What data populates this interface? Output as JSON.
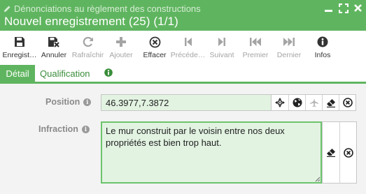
{
  "window": {
    "parent_title": "Dénonciations au règlement des constructions",
    "title": "Nouvel enregistrement (25) (1/1)"
  },
  "toolbar": {
    "buttons": [
      {
        "label": "Enregist…",
        "icon": "save-icon",
        "enabled": true
      },
      {
        "label": "Annuler",
        "icon": "cancel-save-icon",
        "enabled": true
      },
      {
        "label": "Rafraîchir",
        "icon": "refresh-icon",
        "enabled": false
      },
      {
        "label": "Ajouter",
        "icon": "plus-icon",
        "enabled": false
      },
      {
        "label": "Effacer",
        "icon": "delete-icon",
        "enabled": true
      },
      {
        "label": "Précéde…",
        "icon": "previous-icon",
        "enabled": false
      },
      {
        "label": "Suivant",
        "icon": "next-icon",
        "enabled": false
      },
      {
        "label": "Premier",
        "icon": "first-icon",
        "enabled": false
      },
      {
        "label": "Dernier",
        "icon": "last-icon",
        "enabled": false
      },
      {
        "label": "Infos",
        "icon": "info-icon",
        "enabled": true
      }
    ]
  },
  "tabs": [
    {
      "label": "Détail",
      "active": true
    },
    {
      "label": "Qualification",
      "active": false
    }
  ],
  "form": {
    "position": {
      "label": "Position",
      "value": "46.3977,7.3872",
      "tools": [
        "crosshair-icon",
        "globe-icon",
        "airplane-icon",
        "eraser-icon",
        "clear-icon"
      ]
    },
    "infraction": {
      "label": "Infraction",
      "value": "Le mur construit par le voisin entre nos deux propriétés est bien trop haut.",
      "tools": [
        "eraser-icon",
        "clear-icon"
      ]
    }
  },
  "colors": {
    "accent": "#5fb55f",
    "field_bg": "#e2f3e2",
    "disabled_text": "#a4a4a4"
  }
}
